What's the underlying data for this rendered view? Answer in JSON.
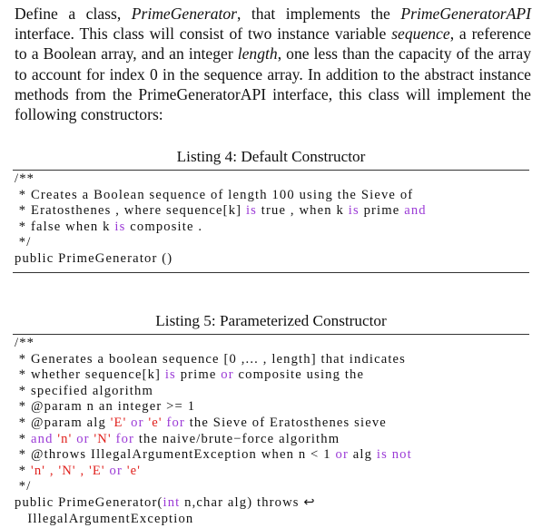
{
  "intro": {
    "p1": "Define a class, ",
    "class_name": "PrimeGenerator",
    "p2": ", that implements the ",
    "interface_name": "PrimeGeneratorAPI",
    "p3": " interface. This class will consist of two instance variable ",
    "var1": "sequence",
    "p4": ", a reference to a Boolean array, and an integer ",
    "var2": "length",
    "p5": ", one less than the capacity of the array to account for index 0 in the sequence array. In addition to the abstract instance methods from the PrimeGeneratorAPI interface, this class will implement the following constructors:"
  },
  "listings": [
    {
      "caption": "Listing 4: Default Constructor",
      "lines": [
        [
          {
            "t": "/**"
          }
        ],
        [
          {
            "t": " * Creates a Boolean sequence of length 100 using the Sieve of"
          }
        ],
        [
          {
            "t": " * Eratosthenes , where sequence[k] "
          },
          {
            "t": "is",
            "c": "kw"
          },
          {
            "t": " true , when k "
          },
          {
            "t": "is",
            "c": "kw"
          },
          {
            "t": " prime "
          },
          {
            "t": "and",
            "c": "kw"
          }
        ],
        [
          {
            "t": " * false when k "
          },
          {
            "t": "is",
            "c": "kw"
          },
          {
            "t": " composite ."
          }
        ],
        [
          {
            "t": " */"
          }
        ],
        [
          {
            "t": "public PrimeGenerator ()"
          }
        ]
      ]
    },
    {
      "caption": "Listing 5: Parameterized Constructor",
      "lines": [
        [
          {
            "t": "/**"
          }
        ],
        [
          {
            "t": " * Generates a boolean sequence [0 ,... , length] that indicates"
          }
        ],
        [
          {
            "t": " * whether sequence[k] "
          },
          {
            "t": "is",
            "c": "kw"
          },
          {
            "t": " prime "
          },
          {
            "t": "or",
            "c": "kw"
          },
          {
            "t": " composite using the"
          }
        ],
        [
          {
            "t": " * specified algorithm"
          }
        ],
        [
          {
            "t": " * @param n an integer >= 1"
          }
        ],
        [
          {
            "t": " * @param alg "
          },
          {
            "t": "'E'",
            "c": "str"
          },
          {
            "t": " "
          },
          {
            "t": "or",
            "c": "kw"
          },
          {
            "t": " "
          },
          {
            "t": "'e'",
            "c": "str"
          },
          {
            "t": " "
          },
          {
            "t": "for",
            "c": "kw"
          },
          {
            "t": " the Sieve of Eratosthenes sieve"
          }
        ],
        [
          {
            "t": " * "
          },
          {
            "t": "and",
            "c": "kw"
          },
          {
            "t": " "
          },
          {
            "t": "'n'",
            "c": "str"
          },
          {
            "t": " "
          },
          {
            "t": "or",
            "c": "kw"
          },
          {
            "t": " "
          },
          {
            "t": "'N'",
            "c": "str"
          },
          {
            "t": " "
          },
          {
            "t": "for",
            "c": "kw"
          },
          {
            "t": " the naive/brute−force algorithm"
          }
        ],
        [
          {
            "t": " * @throws IllegalArgumentException when n < 1 "
          },
          {
            "t": "or",
            "c": "kw"
          },
          {
            "t": " alg "
          },
          {
            "t": "is",
            "c": "kw"
          },
          {
            "t": " "
          },
          {
            "t": "not",
            "c": "kw"
          }
        ],
        [
          {
            "t": " * "
          },
          {
            "t": "'n' , 'N' , 'E'",
            "c": "str"
          },
          {
            "t": " "
          },
          {
            "t": "or",
            "c": "kw"
          },
          {
            "t": " "
          },
          {
            "t": "'e'",
            "c": "str"
          }
        ],
        [
          {
            "t": " */"
          }
        ],
        [
          {
            "t": "public PrimeGenerator("
          },
          {
            "t": "int",
            "c": "kw"
          },
          {
            "t": " n,char alg) throws ↩"
          }
        ],
        [
          {
            "t": "   IllegalArgumentException"
          }
        ]
      ]
    }
  ]
}
